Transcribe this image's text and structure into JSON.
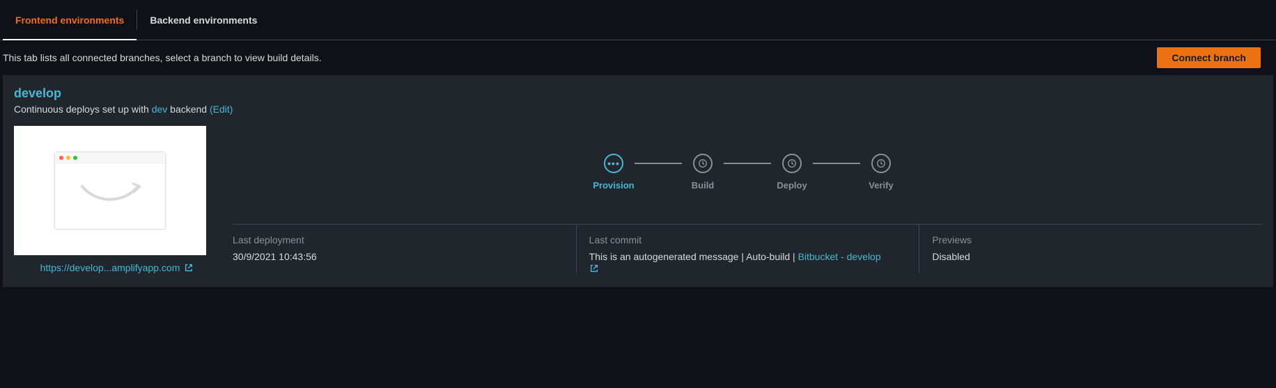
{
  "tabs": {
    "frontend": "Frontend environments",
    "backend": "Backend environments"
  },
  "hint": "This tab lists all connected branches, select a branch to view build details.",
  "connect_button": "Connect branch",
  "branch": {
    "name": "develop",
    "subtitle_prefix": "Continuous deploys set up with ",
    "backend_name": "dev",
    "subtitle_suffix": " backend ",
    "edit_label": "(Edit)",
    "url_display": "https://develop...amplifyapp.com"
  },
  "pipeline": {
    "provision": "Provision",
    "build": "Build",
    "deploy": "Deploy",
    "verify": "Verify"
  },
  "info": {
    "last_deployment_label": "Last deployment",
    "last_deployment_value": "30/9/2021 10:43:56",
    "last_commit_label": "Last commit",
    "last_commit_value_prefix": "This is an autogenerated message | Auto-build | ",
    "last_commit_link": "Bitbucket - develop",
    "previews_label": "Previews",
    "previews_value": "Disabled"
  }
}
